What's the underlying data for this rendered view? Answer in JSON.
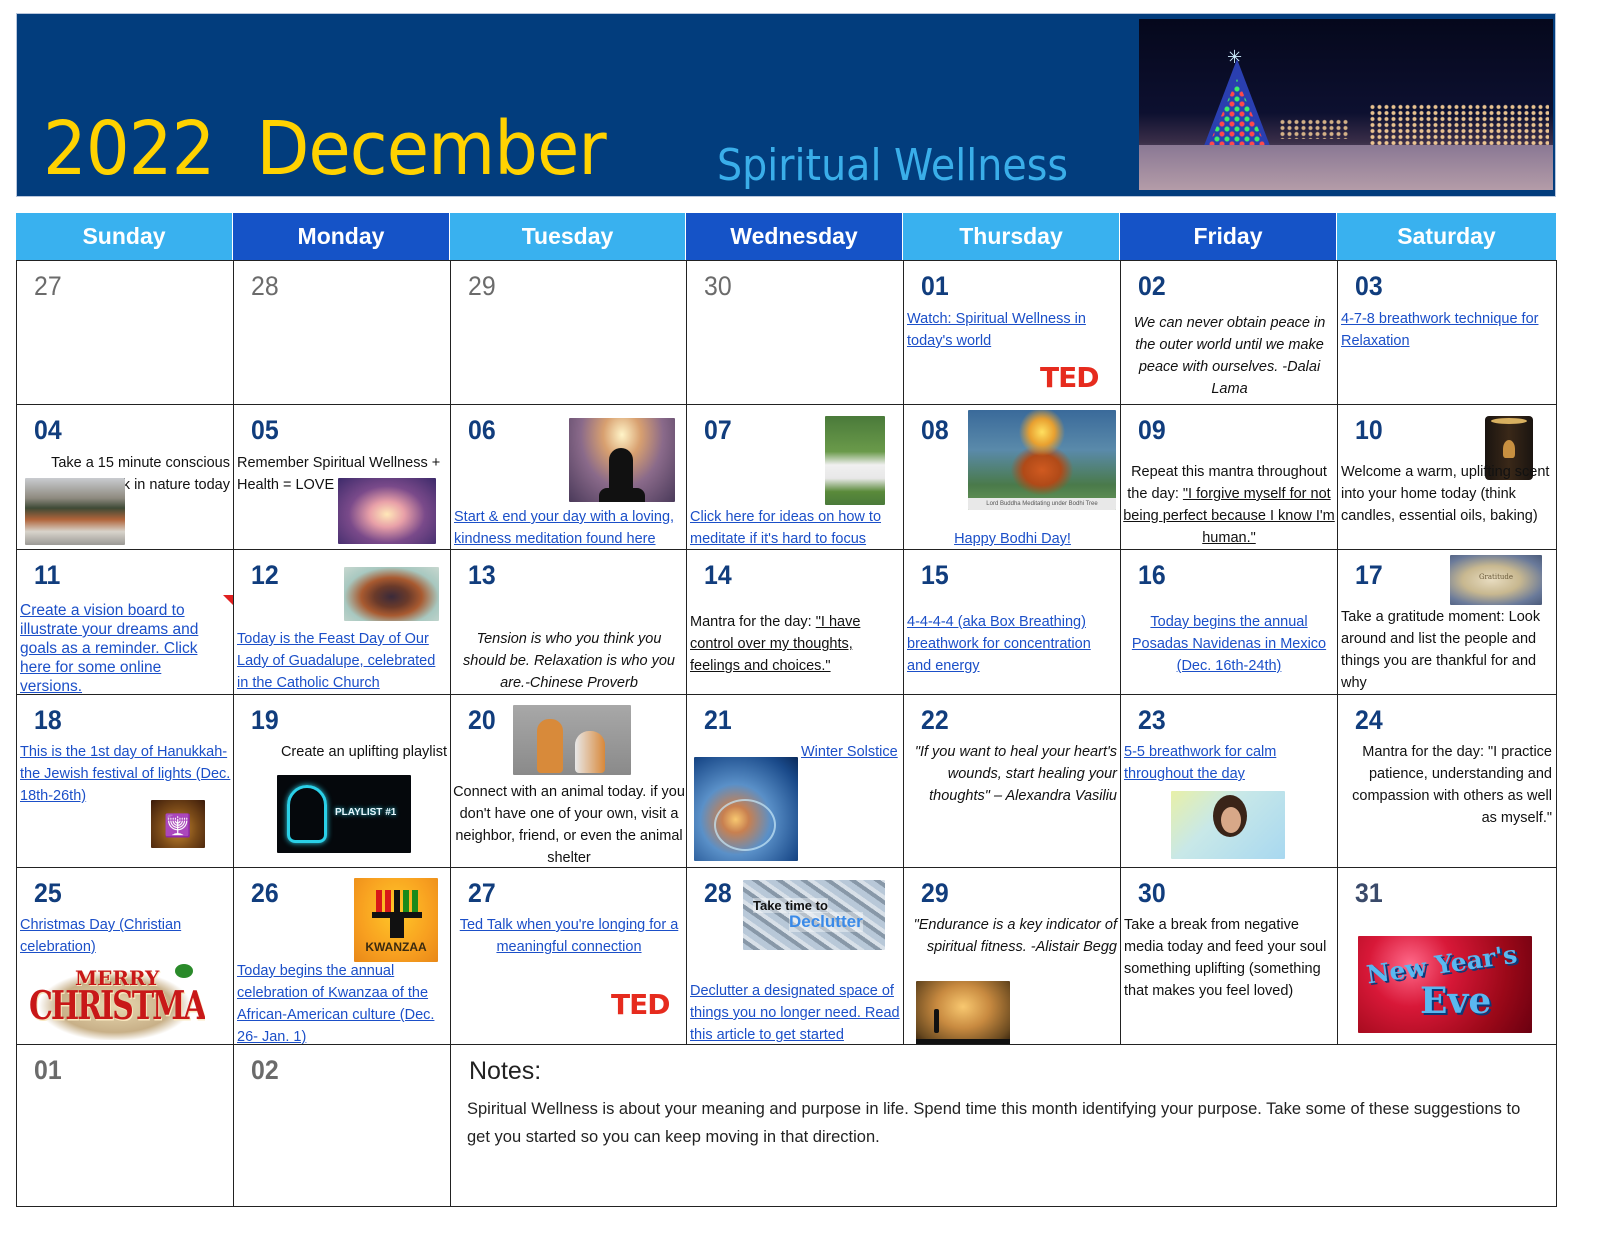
{
  "banner": {
    "title": "2022  December",
    "subtitle": "Spiritual Wellness",
    "photo": "christmas-tree-night-photo",
    "colors": {
      "background": "#023d7d",
      "title": "#ffd200",
      "subtitle": "#3aaee9"
    }
  },
  "weekdays": [
    "Sunday",
    "Monday",
    "Tuesday",
    "Wednesday",
    "Thursday",
    "Friday",
    "Saturday"
  ],
  "header_colors": {
    "light": "#39b1ef",
    "dark": "#1553c7"
  },
  "days": {
    "nov27": {
      "num": "27"
    },
    "nov28": {
      "num": "28"
    },
    "nov29": {
      "num": "29"
    },
    "nov30": {
      "num": "30"
    },
    "d01": {
      "num": "01",
      "link": "Watch: Spiritual Wellness in today's world",
      "logo": "TED"
    },
    "d02": {
      "num": "02",
      "quote": "We can never obtain peace in the outer world until we make peace with ourselves. -Dalai Lama"
    },
    "d03": {
      "num": "03",
      "link": "4-7-8 breathwork technique for Relaxation"
    },
    "d04": {
      "num": "04",
      "text": "Take a 15 minute conscious walk in nature today",
      "image": "nature-river-photo"
    },
    "d05": {
      "num": "05",
      "text": "Remember Spiritual Wellness + Health = LOVE",
      "image": "heart-hands-sunset-photo"
    },
    "d06": {
      "num": "06",
      "link": "Start & end your day with a loving, kindness meditation found here",
      "image": "kindness-chakra-meditation-image"
    },
    "d07": {
      "num": "07",
      "link": "Click here for ideas on how to meditate if it's hard to focus",
      "image": "man-meditating-photo"
    },
    "d08": {
      "num": "08",
      "link": "Happy Bodhi Day!",
      "image": "buddha-under-bodhi-tree-image",
      "caption": "Lord Buddha Meditating under Bodhi Tree"
    },
    "d09": {
      "num": "09",
      "text_pre": "Repeat this mantra throughout the day: ",
      "text_u": "\"I forgive myself for not being perfect because I know I'm human.\""
    },
    "d10": {
      "num": "10",
      "text": "Welcome a warm, uplifting scent into your home today (think candles, essential oils, baking)",
      "image": "candle-photo"
    },
    "d11": {
      "num": "11",
      "link": "Create a vision board to illustrate your dreams and goals as a reminder.  Click here for some online versions."
    },
    "d12": {
      "num": "12",
      "link": "Today is the Feast Day of Our Lady of Guadalupe, celebrated in the Catholic Church",
      "image": "our-lady-of-guadalupe-image"
    },
    "d13": {
      "num": "13",
      "quote": "Tension is who you think you should be. Relaxation is who you are.-Chinese Proverb"
    },
    "d14": {
      "num": "14",
      "text_pre": "Mantra for the day:  ",
      "text_u": "\"I have control over my thoughts, feelings and choices.\""
    },
    "d15": {
      "num": "15",
      "link": "4-4-4-4 (aka Box Breathing) breathwork for concentration and energy"
    },
    "d16": {
      "num": "16",
      "link": "Today begins the annual Posadas Navidenas in Mexico (Dec. 16th-24th)"
    },
    "d17": {
      "num": "17",
      "text": "Take a gratitude moment:  Look around and list the people and things you are thankful for and why",
      "image": "gratitude-stone-photo",
      "image_label": "Gratitude"
    },
    "d18": {
      "num": "18",
      "link": "This is the 1st day of Hanukkah- the Jewish festival of lights (Dec. 18th-26th)",
      "image": "menorah-image"
    },
    "d19": {
      "num": "19",
      "text": "Create an uplifting playlist",
      "image": "headphones-playlist-image",
      "image_label": "PLAYLIST #1"
    },
    "d20": {
      "num": "20",
      "text": "Connect with an animal today.  if you don't have one of your own, visit a neighbor, friend, or even the animal shelter",
      "image": "two-cats-photo"
    },
    "d21": {
      "num": "21",
      "link": "Winter Solstice",
      "image": "winter-solstice-image"
    },
    "d22": {
      "num": "22",
      "quote": "\"If you want to heal your heart's wounds, start healing your thoughts\" – Alexandra Vasiliu"
    },
    "d23": {
      "num": "23",
      "link": "5-5 breathwork for calm throughout the day",
      "image": "woman-breathing-photo"
    },
    "d24": {
      "num": "24",
      "text": "Mantra for the day: \"I practice patience, understanding and compassion with others as well as myself.\""
    },
    "d25": {
      "num": "25",
      "link": "Christmas Day (Christian celebration)",
      "image": "merry-christmas-image",
      "image_label_1": "MERRY",
      "image_label_2": "CHRISTMAS"
    },
    "d26": {
      "num": "26",
      "link": "Today begins the annual celebration of Kwanzaa of the African-American culture (Dec. 26- Jan. 1)",
      "image": "kwanzaa-kinara-image",
      "image_label": "KWANZAA"
    },
    "d27": {
      "num": "27",
      "link": "Ted Talk when you're longing for a meaningful connection",
      "logo": "TED"
    },
    "d28": {
      "num": "28",
      "link": "Declutter a designated space of things you no longer need.  Read this article to get started",
      "image": "declutter-image",
      "image_label_1": "Take time to",
      "image_label_2": "Declutter"
    },
    "d29": {
      "num": "29",
      "quote": "\"Endurance is a key indicator of spiritual fitness. -Alistair Begg",
      "image": "runner-silhouette-photo"
    },
    "d30": {
      "num": "30",
      "text": "Take a break from negative media today and feed your soul something uplifting (something that makes you feel loved)"
    },
    "d31": {
      "num": "31",
      "image": "new-years-eve-image",
      "image_label_1": "New Year's",
      "image_label_2": "Eve"
    },
    "jan01": {
      "num": "01"
    },
    "jan02": {
      "num": "02"
    }
  },
  "notes": {
    "title": "Notes:",
    "body": "Spiritual Wellness is about your meaning and purpose in life.  Spend time this month identifying your purpose.  Take some of these suggestions to get you started so you can keep moving in that direction."
  }
}
